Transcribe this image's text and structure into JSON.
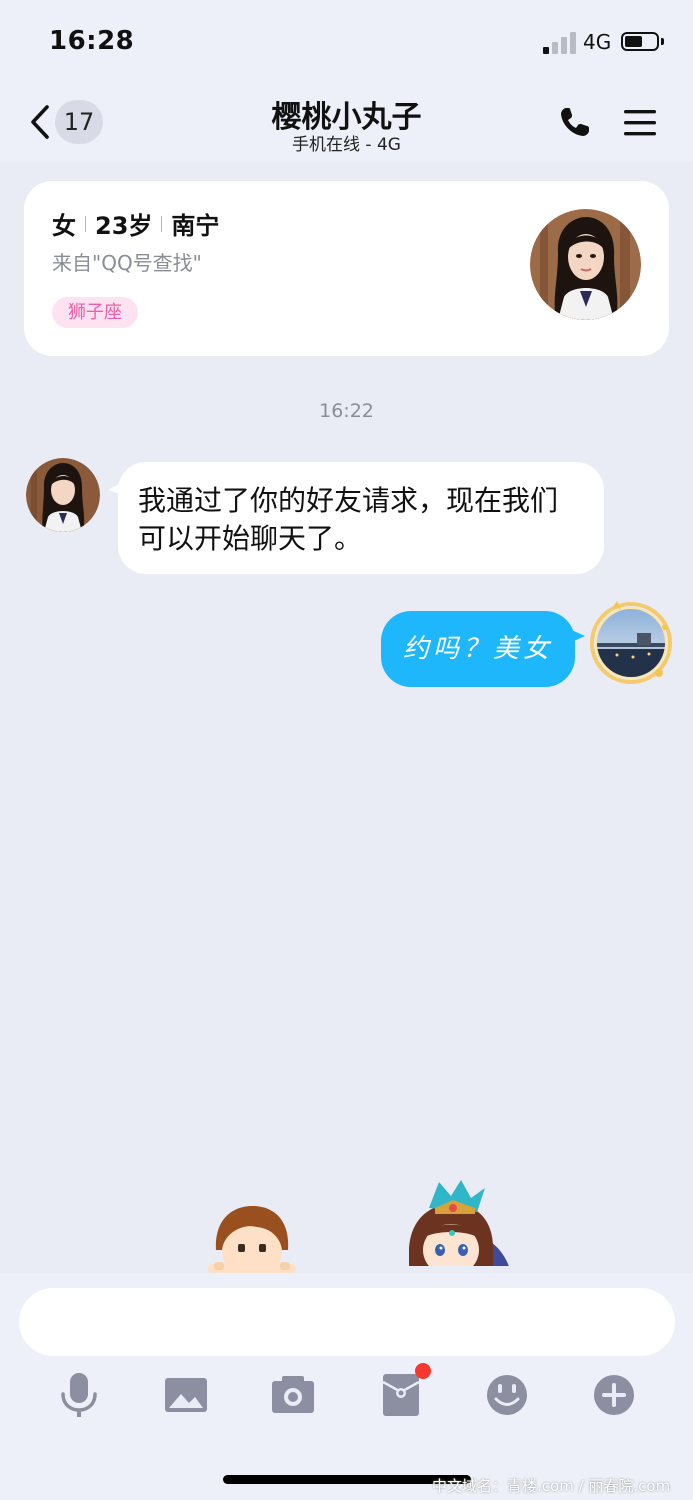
{
  "status_bar": {
    "time": "16:28",
    "network": "4G",
    "signal_bars_filled": 1,
    "signal_bars_total": 4,
    "battery_level": 0.55
  },
  "header": {
    "back_icon": "chevron-left-icon",
    "unread_count": "17",
    "contact_name": "樱桃小丸子",
    "contact_status": "手机在线 - 4G",
    "call_icon": "phone-icon",
    "menu_icon": "hamburger-menu-icon"
  },
  "profile_card": {
    "gender": "女",
    "age": "23岁",
    "city": "南宁",
    "source": "来自\"QQ号查找\"",
    "zodiac_tag": "狮子座",
    "avatar_icon": "contact-avatar"
  },
  "chat": {
    "timestamp": "16:22",
    "messages": [
      {
        "direction": "incoming",
        "text": "我通过了你的好友请求，现在我们可以开始聊天了。"
      },
      {
        "direction": "outgoing",
        "text": "约吗？美女"
      }
    ]
  },
  "stickers": [
    {
      "icon": "cartoon-boy-sticker"
    },
    {
      "icon": "cartoon-warrior-sticker"
    }
  ],
  "input": {
    "value": "",
    "placeholder": ""
  },
  "toolbar": [
    {
      "icon": "microphone-icon"
    },
    {
      "icon": "image-icon"
    },
    {
      "icon": "camera-icon"
    },
    {
      "icon": "red-packet-icon",
      "has_notification_dot": true
    },
    {
      "icon": "emoji-icon"
    },
    {
      "icon": "plus-icon"
    }
  ],
  "watermark": "中文域名：青楼.com / 丽春院.com",
  "colors": {
    "background": "#e9ecf5",
    "outgoing_bubble": "#1eb7fb",
    "incoming_bubble": "#ffffff",
    "zodiac_tag_bg": "#fde2f1",
    "zodiac_tag_text": "#ec5fa9",
    "toolbar_icon": "#8c8fa1",
    "notification_dot": "#f5392f"
  }
}
